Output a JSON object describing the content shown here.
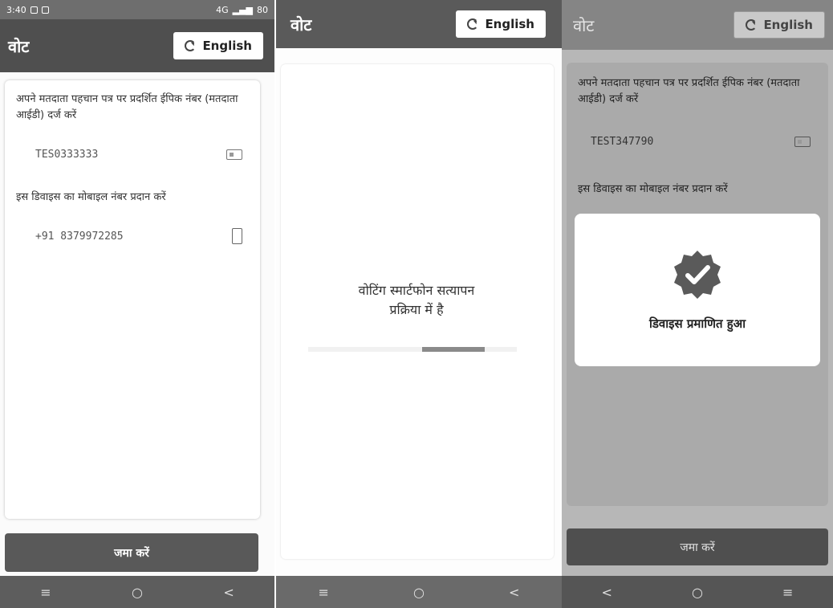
{
  "statusbar": {
    "time": "3:40",
    "network": "4G",
    "battery": "80"
  },
  "colors": {
    "header_dark": "#4f4f4f",
    "button": "#595959"
  },
  "panel1": {
    "title": "वोट",
    "lang_button": "English",
    "epic_prompt": "अपने मतदाता पहचान पत्र पर प्रदर्शित ईपिक नंबर (मतदाता आईडी) दर्ज करें",
    "epic_value": "TES0333333",
    "mobile_prompt": "इस डिवाइस का मोबाइल नंबर प्रदान करें",
    "mobile_value": "+91 8379972285",
    "submit": "जमा करें"
  },
  "panel2": {
    "title": "वोट",
    "lang_button": "English",
    "verify_line1": "वोटिंग स्मार्टफोन सत्यापन",
    "verify_line2": "प्रक्रिया में है",
    "progress": 0.3
  },
  "panel3": {
    "title": "वोट",
    "lang_button": "English",
    "epic_prompt": "अपने मतदाता पहचान पत्र पर प्रदर्शित ईपिक नंबर (मतदाता आईडी) दर्ज करें",
    "epic_value": "TEST347790",
    "mobile_prompt": "इस डिवाइस का मोबाइल नंबर प्रदान करें",
    "modal_text": "डिवाइस प्रमाणित हुआ",
    "submit": "जमा करें"
  },
  "nav": {
    "back": "<",
    "home": "○",
    "menu": "≡"
  }
}
